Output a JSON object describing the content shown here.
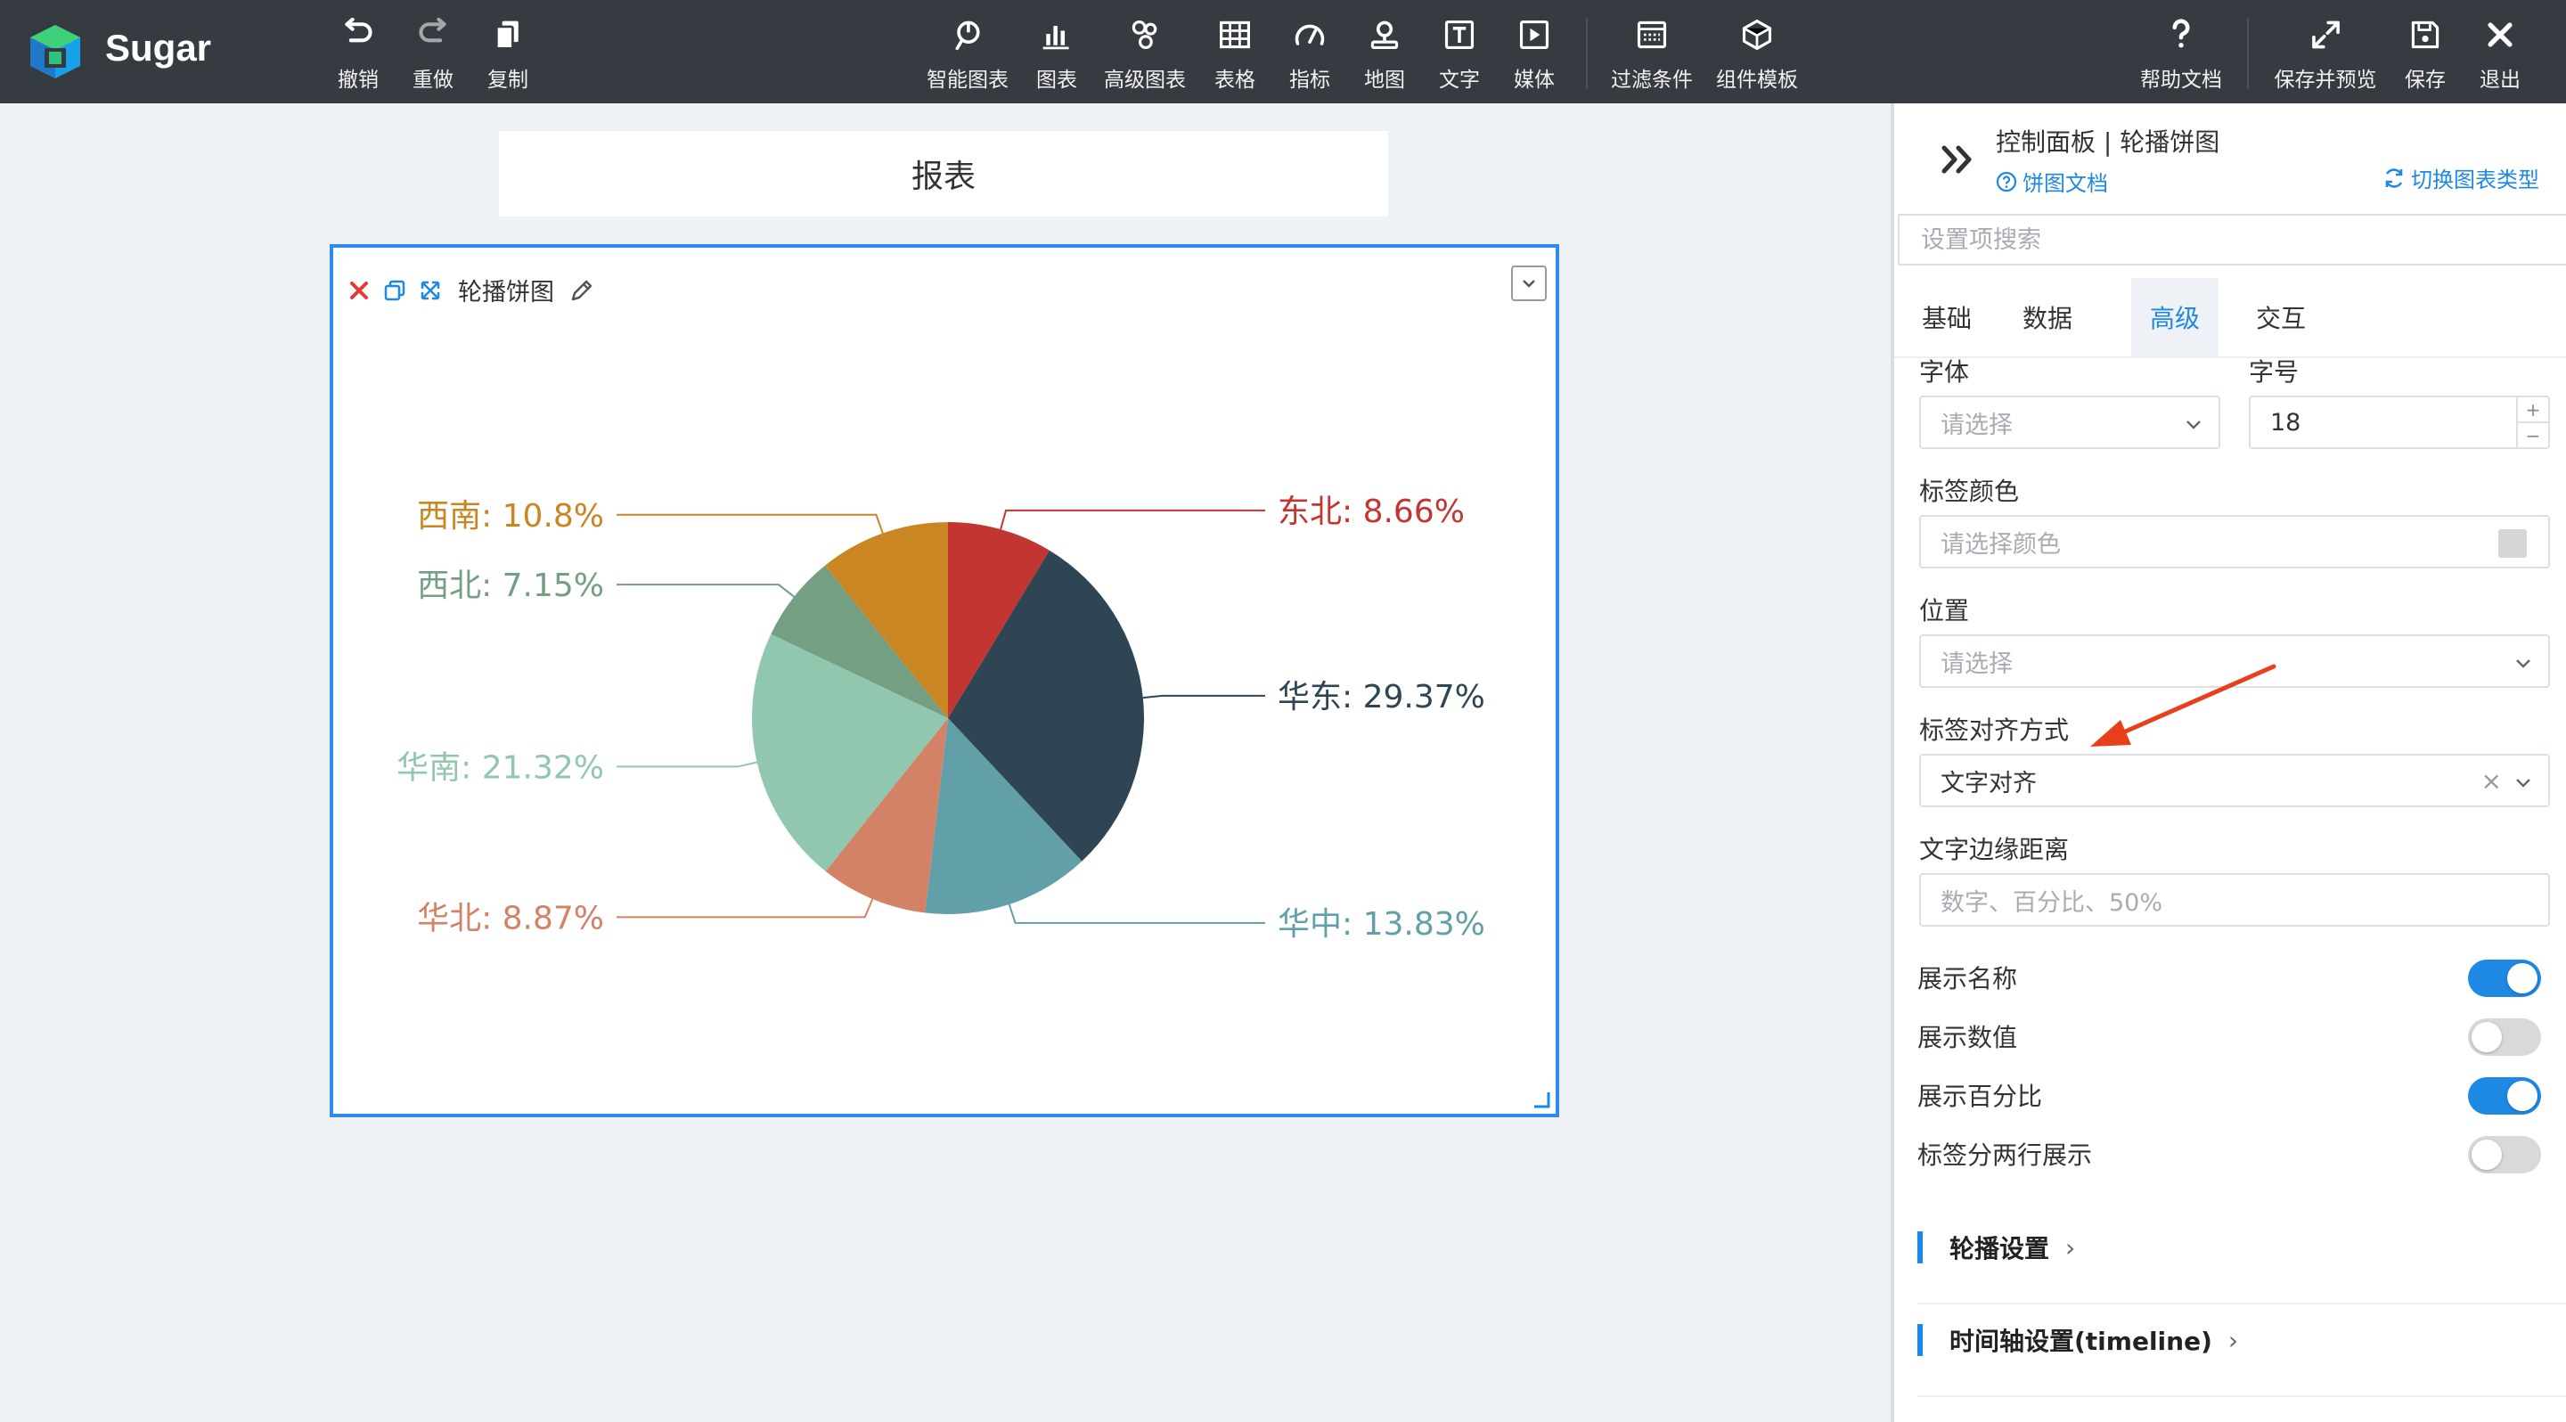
{
  "app": {
    "brand": "Sugar"
  },
  "toolbar": {
    "left": [
      {
        "id": "undo",
        "label": "撤销",
        "icon": "undo-icon",
        "disabled": false
      },
      {
        "id": "redo",
        "label": "重做",
        "icon": "redo-icon",
        "disabled": true
      },
      {
        "id": "copy",
        "label": "复制",
        "icon": "copy-icon",
        "disabled": false
      }
    ],
    "center": [
      {
        "id": "smart-chart",
        "label": "智能图表",
        "icon": "smart-chart-icon"
      },
      {
        "id": "chart",
        "label": "图表",
        "icon": "bar-chart-icon"
      },
      {
        "id": "advanced-chart",
        "label": "高级图表",
        "icon": "advanced-chart-icon"
      },
      {
        "id": "table",
        "label": "表格",
        "icon": "table-icon"
      },
      {
        "id": "metric",
        "label": "指标",
        "icon": "gauge-icon"
      },
      {
        "id": "map",
        "label": "地图",
        "icon": "map-pin-icon"
      },
      {
        "id": "text",
        "label": "文字",
        "icon": "text-icon"
      },
      {
        "id": "media",
        "label": "媒体",
        "icon": "media-play-icon"
      },
      {
        "id": "filter",
        "label": "过滤条件",
        "icon": "filter-icon"
      },
      {
        "id": "template",
        "label": "组件模板",
        "icon": "template-icon"
      }
    ],
    "right": [
      {
        "id": "help",
        "label": "帮助文档",
        "icon": "help-icon"
      },
      {
        "id": "save-preview",
        "label": "保存并预览",
        "icon": "expand-icon"
      },
      {
        "id": "save",
        "label": "保存",
        "icon": "save-icon"
      },
      {
        "id": "exit",
        "label": "退出",
        "icon": "close-icon"
      }
    ]
  },
  "report": {
    "title": "报表"
  },
  "chart_card": {
    "title": "轮播饼图"
  },
  "chart_data": {
    "type": "pie",
    "categories": [
      "东北",
      "华东",
      "华中",
      "华北",
      "华南",
      "西北",
      "西南"
    ],
    "values": [
      8.66,
      29.37,
      13.83,
      8.87,
      21.32,
      7.15,
      10.8
    ],
    "labels": [
      "东北: 8.66%",
      "华东: 29.37%",
      "华中: 13.83%",
      "华北: 8.87%",
      "华南: 21.32%",
      "西北: 7.15%",
      "西南: 10.8%"
    ],
    "colors": [
      "#c23531",
      "#2f4554",
      "#61a0a8",
      "#d48265",
      "#91c7ae",
      "#749f83",
      "#ca8622"
    ],
    "start_angle_deg": 90,
    "direction": "clockwise"
  },
  "panel": {
    "title": "控制面板 | 轮播饼图",
    "doc_link": "饼图文档",
    "switch_link": "切换图表类型",
    "search_placeholder": "设置项搜索",
    "tabs": [
      "基础",
      "数据",
      "高级",
      "交互"
    ],
    "active_tab": 2,
    "font_label": "字体",
    "font_placeholder": "请选择",
    "size_label": "字号",
    "size_value": "18",
    "stepper_plus": "+",
    "stepper_minus": "−",
    "label_color_label": "标签颜色",
    "label_color_placeholder": "请选择颜色",
    "position_label": "位置",
    "position_placeholder": "请选择",
    "align_label": "标签对齐方式",
    "align_value": "文字对齐",
    "align_clear": "×",
    "margin_label": "文字边缘距离",
    "margin_placeholder": "数字、百分比、50%",
    "toggles": [
      {
        "label": "展示名称",
        "on": true
      },
      {
        "label": "展示数值",
        "on": false
      },
      {
        "label": "展示百分比",
        "on": true
      },
      {
        "label": "标签分两行展示",
        "on": false
      }
    ],
    "sections": [
      {
        "label": "轮播设置",
        "arrow": "›"
      },
      {
        "label": "时间轴设置(timeline)",
        "arrow": "›"
      }
    ]
  },
  "annotation": {
    "color": "#e8401c"
  }
}
